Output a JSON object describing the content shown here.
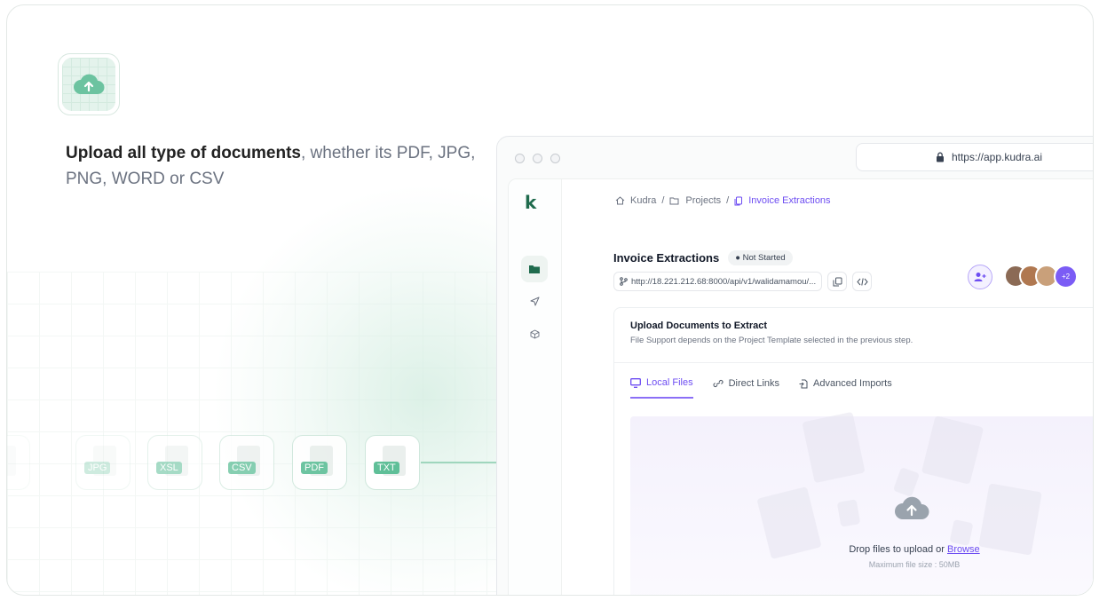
{
  "hero": {
    "headline_bold": "Upload all type of documents",
    "headline_rest": ", whether its PDF, JPG, PNG, WORD or CSV"
  },
  "file_chips": [
    "JPG",
    "XSL",
    "CSV",
    "PDF",
    "TXT"
  ],
  "browser": {
    "url": "https://app.kudra.ai"
  },
  "app": {
    "logo": "k",
    "breadcrumb": [
      "Kudra",
      "Projects",
      "Invoice Extractions"
    ],
    "project_title": "Invoice Extractions",
    "status": "Not Started",
    "endpoint": "http://18.221.212.68:8000/api/v1/walidamamou/...",
    "avatars_more": "+2",
    "panel": {
      "title": "Upload Documents to Extract",
      "subtitle": "File Support depends on the Project Template selected in the previous step.",
      "tabs": [
        "Local Files",
        "Direct Links",
        "Advanced Imports"
      ],
      "drop_text": "Drop files to upload or",
      "browse": "Browse",
      "max_size": "Maximum file size : 50MB"
    }
  },
  "colors": {
    "accent": "#6d4df2",
    "brand_green": "#5fbf98"
  }
}
